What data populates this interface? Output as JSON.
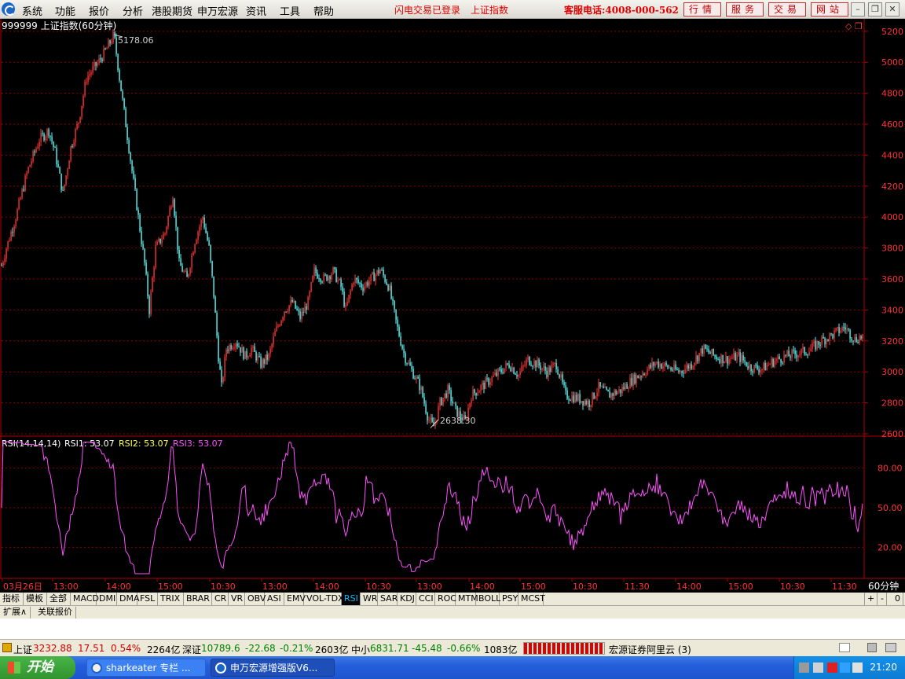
{
  "menu": {
    "items": [
      "系统",
      "功能",
      "报价",
      "分析",
      "港股期货",
      "申万宏源",
      "资讯",
      "工具",
      "帮助"
    ],
    "status_notice": "闪电交易已登录",
    "current_index": "上证指数",
    "hotline": "客服电话:4008-000-562",
    "buttons": [
      "行情",
      "服务",
      "交易",
      "网站"
    ]
  },
  "chart_header": "999999 上证指数(60分钟)",
  "price_axis": [
    "5200",
    "5000",
    "4800",
    "4600",
    "4400",
    "4200",
    "4000",
    "3800",
    "3600",
    "3400",
    "3200",
    "3000",
    "2800",
    "2600"
  ],
  "annotations": {
    "high": "5178.06",
    "low": "2638.30"
  },
  "rsi": {
    "label": "RSI(14,14,14)",
    "rsi1": "RSI1: 53.07",
    "rsi2": "RSI2: 53.07",
    "rsi3": "RSI3: 53.07",
    "axis": [
      "80.00",
      "50.00",
      "20.00"
    ]
  },
  "time_axis": [
    "03月26日",
    "13:00",
    "14:00",
    "15:00",
    "10:30",
    "13:00",
    "14:00",
    "10:30",
    "13:00",
    "14:00",
    "15:00",
    "10:30",
    "11:30",
    "14:00",
    "15:00",
    "10:30",
    "11:30"
  ],
  "period": "60分钟",
  "indicator_tabs": [
    "指标",
    "模板",
    "全部",
    "MACD",
    "DMI",
    "DMA",
    "FSL",
    "TRIX",
    "BRAR",
    "CR",
    "VR",
    "OBV",
    "ASI",
    "EMV",
    "VOL-TDX",
    "RSI",
    "WR",
    "SAR",
    "KDJ",
    "CCI",
    "ROC",
    "MTM",
    "BOLL",
    "PSY",
    "MCST"
  ],
  "active_indicator": "RSI",
  "tab_controls": [
    "+",
    "-",
    "0"
  ],
  "sub_tabs": [
    "扩展∧",
    "关联报价"
  ],
  "status": {
    "sh_name": "上证",
    "sh_value": "3232.88",
    "sh_change": "17.51",
    "sh_pct": "0.54%",
    "sh_amount": "2264亿",
    "sz_name": "深证",
    "sz_value": "10789.6",
    "sz_change": "-22.68",
    "sz_pct": "-0.21%",
    "sz_amount": "2603亿",
    "zx_name": "中小",
    "zx_value": "6831.71",
    "zx_change": "-45.48",
    "zx_pct": "-0.66%",
    "zx_amount": "1083亿",
    "broker": "宏源证券阿里云 (3)"
  },
  "taskbar": {
    "start": "开始",
    "items": [
      "sharkeater 专栏 ...",
      "申万宏源增强版V6..."
    ],
    "clock": "21:20"
  },
  "colors": {
    "up": "#ff3232",
    "down": "#54fcfc",
    "rsi": "#ff50ff",
    "grid": "#8b0000"
  },
  "chart_data": {
    "type": "line",
    "title": "999999 上证指数(60分钟)",
    "price_ylim": [
      2600,
      5250
    ],
    "price_key_points": [
      [
        0,
        3650
      ],
      [
        8,
        3800
      ],
      [
        20,
        4000
      ],
      [
        35,
        4300
      ],
      [
        50,
        4500
      ],
      [
        62,
        4560
      ],
      [
        70,
        4420
      ],
      [
        80,
        4150
      ],
      [
        90,
        4450
      ],
      [
        100,
        4620
      ],
      [
        110,
        4900
      ],
      [
        125,
        5000
      ],
      [
        135,
        5080
      ],
      [
        145,
        5178.06
      ],
      [
        152,
        4900
      ],
      [
        160,
        4600
      ],
      [
        168,
        4300
      ],
      [
        176,
        4000
      ],
      [
        184,
        3700
      ],
      [
        190,
        3400
      ],
      [
        198,
        3800
      ],
      [
        210,
        3900
      ],
      [
        220,
        4150
      ],
      [
        228,
        3700
      ],
      [
        238,
        3600
      ],
      [
        248,
        3850
      ],
      [
        258,
        4000
      ],
      [
        266,
        3800
      ],
      [
        272,
        3500
      ],
      [
        278,
        3100
      ],
      [
        282,
        2900
      ],
      [
        288,
        3150
      ],
      [
        300,
        3200
      ],
      [
        312,
        3100
      ],
      [
        320,
        3150
      ],
      [
        332,
        3050
      ],
      [
        342,
        3100
      ],
      [
        350,
        3250
      ],
      [
        362,
        3400
      ],
      [
        372,
        3450
      ],
      [
        382,
        3350
      ],
      [
        392,
        3450
      ],
      [
        400,
        3650
      ],
      [
        412,
        3600
      ],
      [
        424,
        3650
      ],
      [
        434,
        3550
      ],
      [
        440,
        3400
      ],
      [
        450,
        3600
      ],
      [
        462,
        3550
      ],
      [
        472,
        3600
      ],
      [
        484,
        3660
      ],
      [
        495,
        3550
      ],
      [
        505,
        3300
      ],
      [
        515,
        3100
      ],
      [
        525,
        3000
      ],
      [
        535,
        2900
      ],
      [
        545,
        2700
      ],
      [
        552,
        2638.3
      ],
      [
        560,
        2800
      ],
      [
        570,
        2880
      ],
      [
        580,
        2750
      ],
      [
        592,
        2680
      ],
      [
        600,
        2850
      ],
      [
        612,
        2900
      ],
      [
        624,
        2950
      ],
      [
        636,
        3000
      ],
      [
        648,
        3050
      ],
      [
        660,
        2980
      ],
      [
        672,
        3080
      ],
      [
        684,
        3050
      ],
      [
        696,
        3000
      ],
      [
        708,
        3050
      ],
      [
        720,
        2850
      ],
      [
        735,
        2830
      ],
      [
        750,
        2800
      ],
      [
        762,
        2900
      ],
      [
        775,
        2850
      ],
      [
        790,
        2880
      ],
      [
        805,
        2950
      ],
      [
        820,
        3000
      ],
      [
        835,
        3060
      ],
      [
        850,
        3030
      ],
      [
        865,
        3000
      ],
      [
        880,
        3050
      ],
      [
        895,
        3150
      ],
      [
        910,
        3100
      ],
      [
        925,
        3080
      ],
      [
        940,
        3100
      ],
      [
        955,
        3030
      ],
      [
        970,
        3020
      ],
      [
        985,
        3070
      ],
      [
        1000,
        3100
      ],
      [
        1015,
        3120
      ],
      [
        1030,
        3140
      ],
      [
        1045,
        3200
      ],
      [
        1060,
        3240
      ],
      [
        1075,
        3290
      ],
      [
        1088,
        3210
      ],
      [
        1099,
        3232.88
      ]
    ],
    "rsi_ylim": [
      0,
      100
    ],
    "series": [
      {
        "name": "RSI1",
        "last": 53.07
      },
      {
        "name": "RSI2",
        "last": 53.07
      },
      {
        "name": "RSI3",
        "last": 53.07
      }
    ]
  }
}
